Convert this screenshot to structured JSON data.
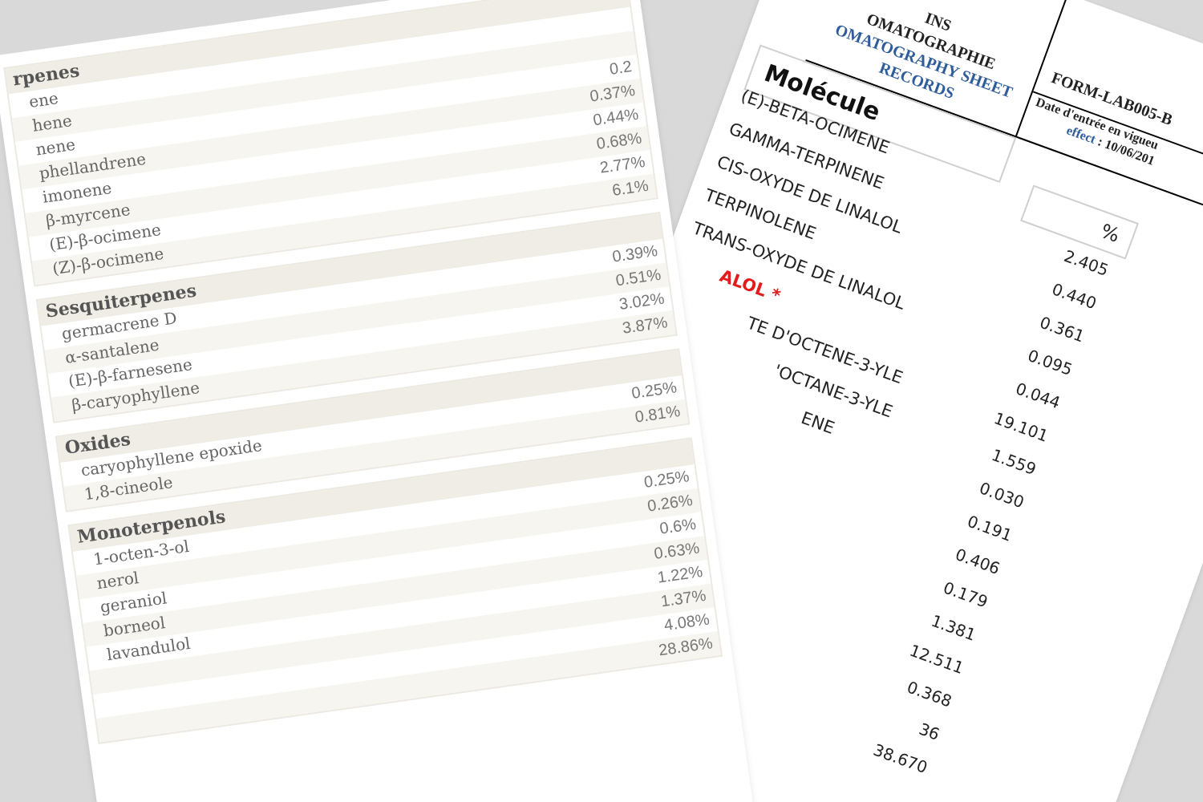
{
  "lab_sheet": {
    "title_lines": [
      "INS",
      "OMATOGRAPHIE",
      "OMATOGRAPHY SHEET",
      "RECORDS"
    ],
    "form_code": "FORM-LAB005-B",
    "date_label": "Date d'entrée en vigueu",
    "effect_label": "effect",
    "effect_date": ": 10/06/201",
    "molecule_header": "Molécule",
    "percent_header": "%",
    "molecules": [
      {
        "name": "(E)-BETA-OCIMENE",
        "color": "#222222"
      },
      {
        "name": "GAMMA-TERPINENE",
        "color": "#222222"
      },
      {
        "name": "CIS-OXYDE DE LINALOL",
        "color": "#222222"
      },
      {
        "name": "TERPINOLENE",
        "color": "#222222"
      },
      {
        "name": "TRANS-OXYDE DE LINALOL",
        "color": "#222222"
      },
      {
        "name": "ALOL *",
        "color": "#e31b1b"
      },
      {
        "name": "TE D'OCTENE-3-YLE",
        "color": "#222222"
      },
      {
        "name": "'OCTANE-3-YLE",
        "color": "#222222"
      },
      {
        "name": "ENE",
        "color": "#222222"
      }
    ],
    "percent_values": [
      "2.405",
      "0.440",
      "0.361",
      "0.095",
      "0.044",
      "19.101",
      "1.559",
      "0.030",
      "0.191",
      "0.406",
      "0.179",
      "1.381",
      "12.511",
      "0.368",
      "36",
      "38.670"
    ]
  },
  "composition_sheet": {
    "sections": [
      {
        "title": "rpenes",
        "rows": [
          {
            "name": "ene"
          },
          {
            "name": "hene"
          },
          {
            "name": "nene",
            "value": "0.2"
          },
          {
            "name": "phellandrene",
            "value": "0.37%"
          },
          {
            "name": "imonene",
            "value": "0.44%"
          },
          {
            "name": "β-myrcene",
            "value": "0.68%"
          },
          {
            "name": "(E)-β-ocimene",
            "value": "2.77%"
          },
          {
            "name": "(Z)-β-ocimene",
            "value": "6.1%"
          }
        ]
      },
      {
        "title": "Sesquiterpenes",
        "rows": [
          {
            "name": "germacrene D",
            "value": "0.39%"
          },
          {
            "name": "α-santalene",
            "value": "0.51%"
          },
          {
            "name": "(E)-β-farnesene",
            "value": "3.02%"
          },
          {
            "name": "β-caryophyllene",
            "value": "3.87%"
          }
        ]
      },
      {
        "title": "Oxides",
        "rows": [
          {
            "name": "caryophyllene epoxide",
            "value": "0.25%"
          },
          {
            "name": "1,8-cineole",
            "value": "0.81%"
          }
        ]
      },
      {
        "title": "Monoterpenols",
        "rows": [
          {
            "name": "1-octen-3-ol",
            "value": "0.25%"
          },
          {
            "name": "nerol",
            "value": "0.26%"
          },
          {
            "name": "geraniol",
            "value": "0.6%"
          },
          {
            "name": "borneol",
            "value": "0.63%"
          },
          {
            "name": "lavandulol",
            "value": "1.22%"
          },
          {
            "value": "1.37%"
          },
          {
            "value": "4.08%"
          },
          {
            "value": "28.86%"
          }
        ]
      }
    ]
  }
}
